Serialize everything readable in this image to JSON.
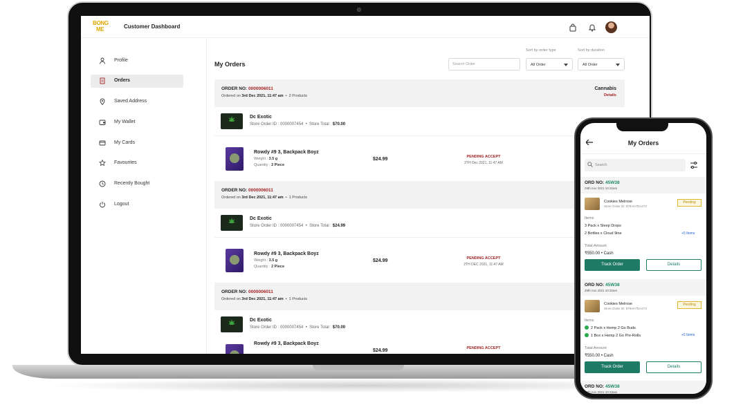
{
  "header": {
    "logo_line1": "BONG",
    "logo_line2": "ME",
    "title": "Customer Dashboard"
  },
  "sidebar": {
    "items": [
      {
        "label": "Profile",
        "icon": "user-icon",
        "active": false
      },
      {
        "label": "Orders",
        "icon": "orders-icon",
        "active": true
      },
      {
        "label": "Saved Address",
        "icon": "location-pin-icon",
        "active": false
      },
      {
        "label": "My Wallet",
        "icon": "wallet-icon",
        "active": false
      },
      {
        "label": "My Cards",
        "icon": "card-icon",
        "active": false
      },
      {
        "label": "Favourites",
        "icon": "star-icon",
        "active": false
      },
      {
        "label": "Recently Bought",
        "icon": "clock-icon",
        "active": false
      },
      {
        "label": "Logout",
        "icon": "power-icon",
        "active": false
      }
    ]
  },
  "main": {
    "title": "My Orders",
    "search_placeholder": "Search Order",
    "sort_type_label": "Sort by order type",
    "sort_type_value": "All Order",
    "sort_duration_label": "Sort by duration",
    "sort_duration_value": "All Order",
    "orders": [
      {
        "no_label": "ORDER NO:",
        "no": "0000006011",
        "ordered_on_label": "Ordered on",
        "ordered_on": "3rd Dec 2021, 11:47 am",
        "products": "2 Products",
        "category": "Cannabis",
        "details": "Details",
        "store_name": "Dc Exotic",
        "store_order_id": "Store Order ID : 0000007454",
        "store_total_label": "Store Total :",
        "store_total": "$70.00",
        "product": {
          "name": "Rowdy #9 3, Backpack Boyz",
          "weight_label": "Weight :",
          "weight": "3.5 g",
          "quantity_label": "Quantity :",
          "quantity": "2 Piece",
          "price": "$24.99",
          "status": "PENDING ACCEPT",
          "date": "2TH Dec 2021, 11:47 AM"
        }
      },
      {
        "no_label": "ORDER NO:",
        "no": "0000006011",
        "ordered_on_label": "Ordered on",
        "ordered_on": "3rd Dec 2021, 11:47 am",
        "products": "1 Products",
        "store_name": "Dc Exotic",
        "store_order_id": "Store Order ID : 0000007454",
        "store_total_label": "Store Total :",
        "store_total": "$24.99",
        "product": {
          "name": "Rowdy #9 3, Backpack Boyz",
          "weight_label": "Weight :",
          "weight": "3.5 g",
          "quantity_label": "Quantity :",
          "quantity": "2 Piece",
          "price": "$24.99",
          "status": "PENDING ACCEPT",
          "date": "2TH DEC 2021, 11:47 AM"
        }
      },
      {
        "no_label": "ORDER NO:",
        "no": "0000006011",
        "ordered_on_label": "Ordered on",
        "ordered_on": "3rd Dec 2021, 11:47 am",
        "products": "1 Products",
        "store_name": "Dc Exotic",
        "store_order_id": "Store Order ID : 0000007454",
        "store_total_label": "Store Total :",
        "store_total": "$70.00",
        "product": {
          "name": "Rowdy #9 3, Backpack Boyz",
          "price": "$24.99",
          "status": "PENDING ACCEPT"
        }
      }
    ]
  },
  "phone": {
    "title": "My Orders",
    "search_placeholder": "Search",
    "orders": [
      {
        "no_label": "ORD NO:",
        "no": "45W38",
        "date": "29th nov 2021 10:32am",
        "product_name": "Cookies Melrose",
        "store_order_id": "Store Order ID: 879AH7DA473",
        "status": "Pending",
        "items_label": "Items",
        "items": [
          "3 Pack x Sleep Drops",
          "2 Bottles x Cloud 9ine"
        ],
        "more": "+5 Items",
        "total_label": "Total Amount",
        "total": "₹550.00 • Cash",
        "track": "Track Order",
        "details": "Details"
      },
      {
        "no_label": "ORD NO:",
        "no": "45W38",
        "date": "29th nov 2021 10:32am",
        "product_name": "Cookies Melrose",
        "store_order_id": "Store Order ID: 879AH7DA473",
        "status": "Pending",
        "items_label": "Items",
        "items": [
          "2 Pack x Hemp 2 Go Buds",
          "1 Box x Hemp 2 Go Pre-Rolls"
        ],
        "more": "+5 Items",
        "total_label": "Total Amount",
        "total": "₹550.00 • Cash",
        "track": "Track Order",
        "details": "Details"
      },
      {
        "no_label": "ORD NO:",
        "no": "45W38",
        "date": "29th nov 2021 10:32am"
      }
    ]
  },
  "colors": {
    "accent_red": "#a02222",
    "accent_green": "#1f7a66",
    "pending_yellow": "#e3b62a"
  }
}
